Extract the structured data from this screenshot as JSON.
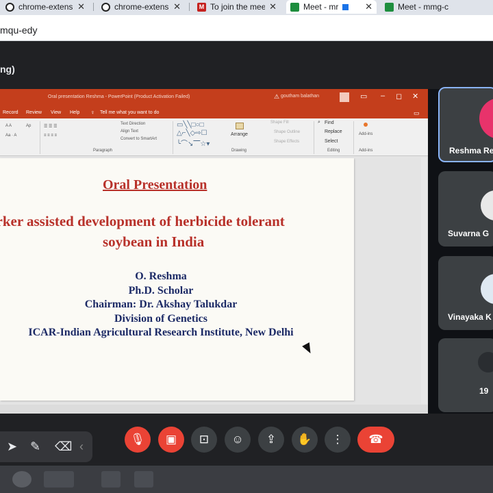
{
  "browser": {
    "tabs": [
      {
        "title": "chrome-extens",
        "close": "✕",
        "icon": "chrome-extension-icon"
      },
      {
        "title": "chrome-extens",
        "close": "✕",
        "icon": "chrome-extension-icon"
      },
      {
        "title": "To join the mee",
        "close": "✕",
        "icon": "gmail-icon"
      },
      {
        "title": "Meet - mr",
        "close": "✕",
        "icon": "meet-icon"
      },
      {
        "title": "Meet - mmg-c",
        "close": "✕",
        "icon": "meet-icon"
      }
    ],
    "url": "mqu-edy"
  },
  "meet": {
    "presenting_label": "ng)",
    "participants": [
      {
        "name": "Reshma Re"
      },
      {
        "name": "Suvarna G"
      },
      {
        "name": "Vinayaka K"
      },
      {
        "name": "19"
      }
    ]
  },
  "powerpoint": {
    "title": "Oral presentation Reshma - PowerPoint (Product Activation Failed)",
    "user": "goutham balathan",
    "tabs": [
      "Record",
      "Review",
      "View",
      "Help",
      "Tell me what you want to do"
    ],
    "ribbon": {
      "text_direction": "Text Direction",
      "align_text": "Align Text",
      "convert_smartart": "Convert to SmartArt",
      "paragraph_label": "Paragraph",
      "arrange": "Arrange",
      "drawing_label": "Drawing",
      "shape_fill": "Shape Fill",
      "shape_outline": "Shape Outline",
      "shape_effects": "Shape Effects",
      "find": "Find",
      "replace": "Replace",
      "select": "Select",
      "editing_label": "Editing",
      "addins": "Add-ins",
      "addins_group": "Add-ins"
    }
  },
  "slide": {
    "heading": "Oral Presentation",
    "title_line1": "arker assisted development of herbicide tolerant",
    "title_line2": "soybean in India",
    "lines": [
      "O. Reshma",
      "Ph.D. Scholar",
      "Chairman: Dr. Akshay Talukdar",
      "Division of Genetics",
      "ICAR-Indian Agricultural Research Institute, New Delhi"
    ]
  },
  "colors": {
    "powerpoint_accent": "#c43e1c",
    "slide_heading": "#b8312a",
    "slide_body": "#1c2a66",
    "meet_red": "#ea4335"
  }
}
